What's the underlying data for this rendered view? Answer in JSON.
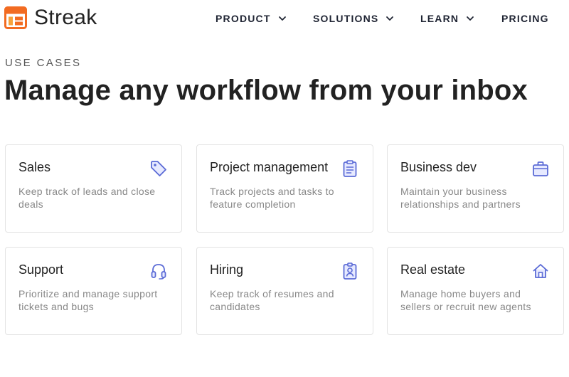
{
  "brand": {
    "name": "Streak",
    "logo_icon": "streak-logo-icon",
    "logo_color": "#f26b21"
  },
  "nav": {
    "items": [
      {
        "label": "PRODUCT",
        "has_dropdown": true
      },
      {
        "label": "SOLUTIONS",
        "has_dropdown": true
      },
      {
        "label": "LEARN",
        "has_dropdown": true
      },
      {
        "label": "PRICING",
        "has_dropdown": false
      }
    ]
  },
  "hero": {
    "eyebrow": "USE CASES",
    "title": "Manage any workflow from your inbox"
  },
  "colors": {
    "icon_accent": "#5b6bd6",
    "icon_fill": "#e7eaff",
    "title_text": "#222222",
    "description_text": "#888888",
    "card_border": "#e3e3e3"
  },
  "cards": [
    {
      "title": "Sales",
      "description": "Keep track of leads and close deals",
      "icon": "tag-icon"
    },
    {
      "title": "Project management",
      "description": "Track projects and tasks to feature completion",
      "icon": "clipboard-icon"
    },
    {
      "title": "Business dev",
      "description": "Maintain your business relationships and partners",
      "icon": "briefcase-icon"
    },
    {
      "title": "Support",
      "description": "Prioritize and manage support tickets and bugs",
      "icon": "headset-icon"
    },
    {
      "title": "Hiring",
      "description": "Keep track of resumes and candidates",
      "icon": "id-badge-icon"
    },
    {
      "title": "Real estate",
      "description": "Manage home buyers and sellers or recruit new agents",
      "icon": "house-icon"
    }
  ]
}
